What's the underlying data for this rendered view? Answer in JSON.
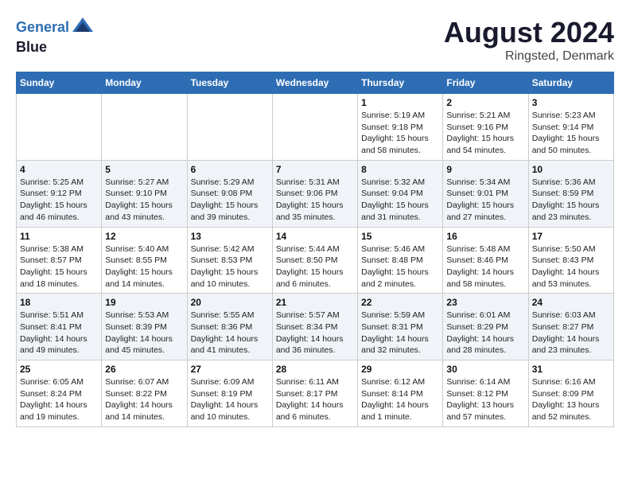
{
  "logo": {
    "line1": "General",
    "line2": "Blue"
  },
  "title": "August 2024",
  "subtitle": "Ringsted, Denmark",
  "days_of_week": [
    "Sunday",
    "Monday",
    "Tuesday",
    "Wednesday",
    "Thursday",
    "Friday",
    "Saturday"
  ],
  "weeks": [
    [
      {
        "num": "",
        "info": ""
      },
      {
        "num": "",
        "info": ""
      },
      {
        "num": "",
        "info": ""
      },
      {
        "num": "",
        "info": ""
      },
      {
        "num": "1",
        "info": "Sunrise: 5:19 AM\nSunset: 9:18 PM\nDaylight: 15 hours\nand 58 minutes."
      },
      {
        "num": "2",
        "info": "Sunrise: 5:21 AM\nSunset: 9:16 PM\nDaylight: 15 hours\nand 54 minutes."
      },
      {
        "num": "3",
        "info": "Sunrise: 5:23 AM\nSunset: 9:14 PM\nDaylight: 15 hours\nand 50 minutes."
      }
    ],
    [
      {
        "num": "4",
        "info": "Sunrise: 5:25 AM\nSunset: 9:12 PM\nDaylight: 15 hours\nand 46 minutes."
      },
      {
        "num": "5",
        "info": "Sunrise: 5:27 AM\nSunset: 9:10 PM\nDaylight: 15 hours\nand 43 minutes."
      },
      {
        "num": "6",
        "info": "Sunrise: 5:29 AM\nSunset: 9:08 PM\nDaylight: 15 hours\nand 39 minutes."
      },
      {
        "num": "7",
        "info": "Sunrise: 5:31 AM\nSunset: 9:06 PM\nDaylight: 15 hours\nand 35 minutes."
      },
      {
        "num": "8",
        "info": "Sunrise: 5:32 AM\nSunset: 9:04 PM\nDaylight: 15 hours\nand 31 minutes."
      },
      {
        "num": "9",
        "info": "Sunrise: 5:34 AM\nSunset: 9:01 PM\nDaylight: 15 hours\nand 27 minutes."
      },
      {
        "num": "10",
        "info": "Sunrise: 5:36 AM\nSunset: 8:59 PM\nDaylight: 15 hours\nand 23 minutes."
      }
    ],
    [
      {
        "num": "11",
        "info": "Sunrise: 5:38 AM\nSunset: 8:57 PM\nDaylight: 15 hours\nand 18 minutes."
      },
      {
        "num": "12",
        "info": "Sunrise: 5:40 AM\nSunset: 8:55 PM\nDaylight: 15 hours\nand 14 minutes."
      },
      {
        "num": "13",
        "info": "Sunrise: 5:42 AM\nSunset: 8:53 PM\nDaylight: 15 hours\nand 10 minutes."
      },
      {
        "num": "14",
        "info": "Sunrise: 5:44 AM\nSunset: 8:50 PM\nDaylight: 15 hours\nand 6 minutes."
      },
      {
        "num": "15",
        "info": "Sunrise: 5:46 AM\nSunset: 8:48 PM\nDaylight: 15 hours\nand 2 minutes."
      },
      {
        "num": "16",
        "info": "Sunrise: 5:48 AM\nSunset: 8:46 PM\nDaylight: 14 hours\nand 58 minutes."
      },
      {
        "num": "17",
        "info": "Sunrise: 5:50 AM\nSunset: 8:43 PM\nDaylight: 14 hours\nand 53 minutes."
      }
    ],
    [
      {
        "num": "18",
        "info": "Sunrise: 5:51 AM\nSunset: 8:41 PM\nDaylight: 14 hours\nand 49 minutes."
      },
      {
        "num": "19",
        "info": "Sunrise: 5:53 AM\nSunset: 8:39 PM\nDaylight: 14 hours\nand 45 minutes."
      },
      {
        "num": "20",
        "info": "Sunrise: 5:55 AM\nSunset: 8:36 PM\nDaylight: 14 hours\nand 41 minutes."
      },
      {
        "num": "21",
        "info": "Sunrise: 5:57 AM\nSunset: 8:34 PM\nDaylight: 14 hours\nand 36 minutes."
      },
      {
        "num": "22",
        "info": "Sunrise: 5:59 AM\nSunset: 8:31 PM\nDaylight: 14 hours\nand 32 minutes."
      },
      {
        "num": "23",
        "info": "Sunrise: 6:01 AM\nSunset: 8:29 PM\nDaylight: 14 hours\nand 28 minutes."
      },
      {
        "num": "24",
        "info": "Sunrise: 6:03 AM\nSunset: 8:27 PM\nDaylight: 14 hours\nand 23 minutes."
      }
    ],
    [
      {
        "num": "25",
        "info": "Sunrise: 6:05 AM\nSunset: 8:24 PM\nDaylight: 14 hours\nand 19 minutes."
      },
      {
        "num": "26",
        "info": "Sunrise: 6:07 AM\nSunset: 8:22 PM\nDaylight: 14 hours\nand 14 minutes."
      },
      {
        "num": "27",
        "info": "Sunrise: 6:09 AM\nSunset: 8:19 PM\nDaylight: 14 hours\nand 10 minutes."
      },
      {
        "num": "28",
        "info": "Sunrise: 6:11 AM\nSunset: 8:17 PM\nDaylight: 14 hours\nand 6 minutes."
      },
      {
        "num": "29",
        "info": "Sunrise: 6:12 AM\nSunset: 8:14 PM\nDaylight: 14 hours\nand 1 minute."
      },
      {
        "num": "30",
        "info": "Sunrise: 6:14 AM\nSunset: 8:12 PM\nDaylight: 13 hours\nand 57 minutes."
      },
      {
        "num": "31",
        "info": "Sunrise: 6:16 AM\nSunset: 8:09 PM\nDaylight: 13 hours\nand 52 minutes."
      }
    ]
  ]
}
